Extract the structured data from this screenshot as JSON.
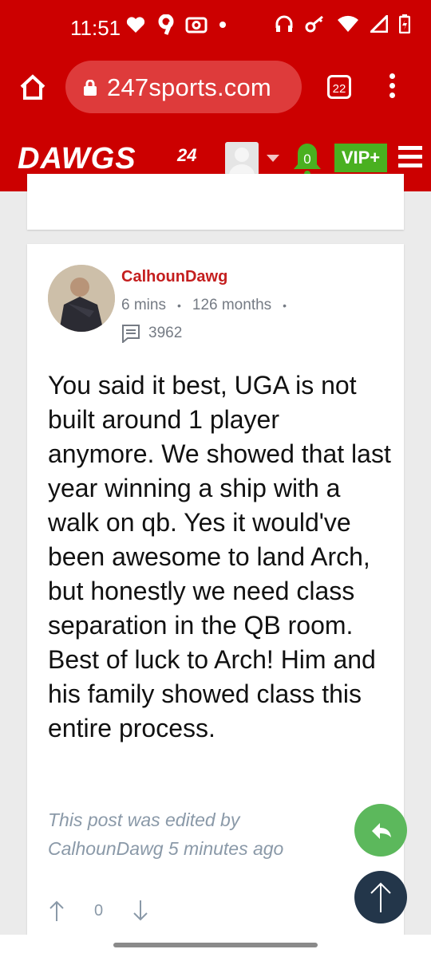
{
  "status_bar": {
    "time": "11:51",
    "left_icons": [
      "heart-icon",
      "nine-icon",
      "camera-icon",
      "dot-icon"
    ],
    "right_icons": [
      "headset-icon",
      "key-icon",
      "wifi-icon",
      "signal-icon",
      "battery-icon"
    ]
  },
  "browser": {
    "url": "247sports.com",
    "tab_count": "22"
  },
  "site_header": {
    "logo": "DAWGS",
    "logo_suffix": "24",
    "notification_count": "0",
    "vip_label": "VIP+"
  },
  "post": {
    "username": "CalhounDawg",
    "time_ago": "6 mins",
    "member_for": "126 months",
    "post_count": "3962",
    "body": "You said it best, UGA is not built around 1 player anymore. We showed that last year winning a ship with a walk on qb. Yes it would've been awesome to land Arch, but honestly we need class separation in the QB room. Best of luck to Arch! Him and his family showed class this entire process.",
    "edited_note": "This post was edited by CalhounDawg 5 minutes ago",
    "vote_count": "0"
  },
  "colors": {
    "brand_red": "#cc0000",
    "vip_green": "#4ab020",
    "username_red": "#c41e1e",
    "reply_green": "#5cb85c",
    "top_navy": "#23364a"
  }
}
